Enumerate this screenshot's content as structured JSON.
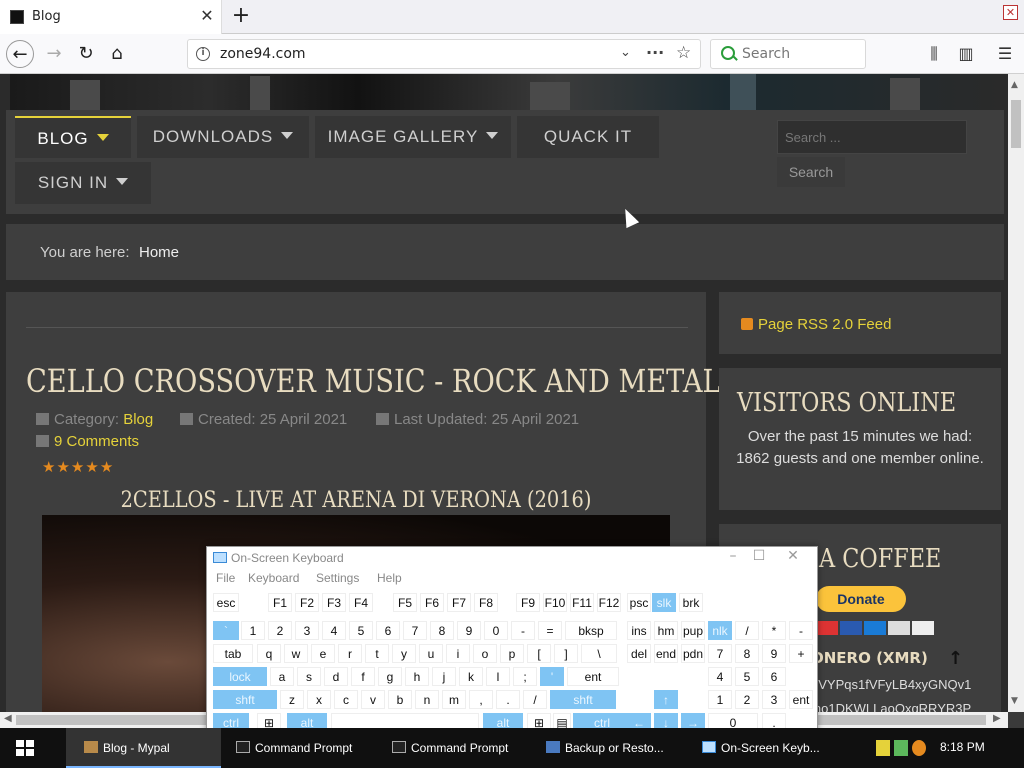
{
  "browser": {
    "tab_title": "Blog",
    "url": "zone94.com",
    "search_placeholder": "Search"
  },
  "site": {
    "menu": [
      {
        "label": "BLOG",
        "has_caret": true,
        "active": true
      },
      {
        "label": "DOWNLOADS",
        "has_caret": true
      },
      {
        "label": "IMAGE GALLERY",
        "has_caret": true
      },
      {
        "label": "QUACK IT",
        "has_caret": false
      },
      {
        "label": "SIGN IN",
        "has_caret": true
      }
    ],
    "search_placeholder": "Search ...",
    "search_button": "Search",
    "breadcrumb_label": "You are here:",
    "breadcrumb_home": "Home"
  },
  "article": {
    "title": "CELLO CROSSOVER MUSIC - ROCK AND METAL",
    "category_label": "Category:",
    "category": "Blog",
    "created": "Created: 25 April 2021",
    "updated": "Last Updated: 25 April 2021",
    "comments": "9 Comments",
    "rating_stars": 5,
    "subtitle": "2CELLOS - LIVE AT ARENA DI VERONA (2016)"
  },
  "sidebar": {
    "rss": "Page RSS 2.0 Feed",
    "visitors_title": "VISITORS ONLINE",
    "visitors_text": "Over the past 15 minutes we had: 1862 guests and one member online.",
    "coffee_title": "A COFFEE",
    "donate_label": "Donate",
    "monero_title": "ONERO (XMR)",
    "monero_addr_1": "nVYPqs1fVFyLB4xyGNQv1",
    "monero_addr_2": "lno1DKWLLaoQxqRRYR3P"
  },
  "osk": {
    "title": "On-Screen Keyboard",
    "menu": [
      "File",
      "Keyboard",
      "Settings",
      "Help"
    ],
    "rows": [
      [
        "esc",
        "F1",
        "F2",
        "F3",
        "F4",
        "F5",
        "F6",
        "F7",
        "F8",
        "F9",
        "F10",
        "F11",
        "F12",
        "psc",
        "slk",
        "brk"
      ],
      [
        "`",
        "1",
        "2",
        "3",
        "4",
        "5",
        "6",
        "7",
        "8",
        "9",
        "0",
        "-",
        "=",
        "bksp",
        "ins",
        "hm",
        "pup",
        "nlk",
        "/",
        "*",
        "-"
      ],
      [
        "tab",
        "q",
        "w",
        "e",
        "r",
        "t",
        "y",
        "u",
        "i",
        "o",
        "p",
        "[",
        "]",
        "\\",
        "del",
        "end",
        "pdn",
        "7",
        "8",
        "9",
        "+"
      ],
      [
        "lock",
        "a",
        "s",
        "d",
        "f",
        "g",
        "h",
        "j",
        "k",
        "l",
        ";",
        "'",
        "ent",
        "4",
        "5",
        "6"
      ],
      [
        "shft",
        "z",
        "x",
        "c",
        "v",
        "b",
        "n",
        "m",
        ",",
        ".",
        "/",
        "shft",
        "↑",
        "1",
        "2",
        "3",
        "ent"
      ],
      [
        "ctrl",
        "alt",
        "alt",
        "ctrl",
        "←",
        "↓",
        "→",
        "0",
        "."
      ]
    ]
  },
  "taskbar": {
    "items": [
      "Blog - Mypal",
      "Command Prompt",
      "Command Prompt",
      "Backup or Resto...",
      "On-Screen Keyb..."
    ],
    "time": "8:18 PM"
  }
}
